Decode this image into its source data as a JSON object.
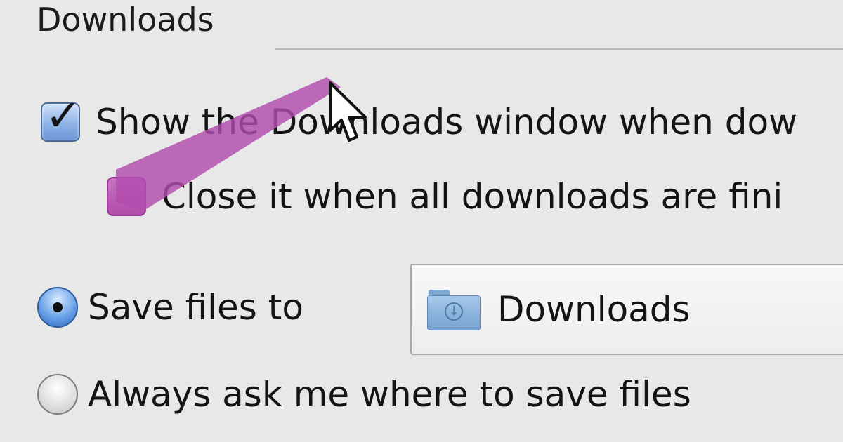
{
  "section": {
    "title": "Downloads"
  },
  "options": {
    "show_window": {
      "label": "Show the Downloads window when dow",
      "checked": true
    },
    "close_when_done": {
      "label": "Close it when all downloads are fini",
      "checked": false
    }
  },
  "save": {
    "save_to_label": "Save files to",
    "folder_name": "Downloads",
    "ask_label": "Always ask me where to save files",
    "selected": "save_to"
  },
  "colors": {
    "highlight": "#b24cad",
    "checkbox_blue": "#7aa3e0",
    "radio_blue": "#2b66c1"
  },
  "icons": {
    "folder": "downloads-folder-icon",
    "cursor": "mouse-pointer-icon"
  }
}
